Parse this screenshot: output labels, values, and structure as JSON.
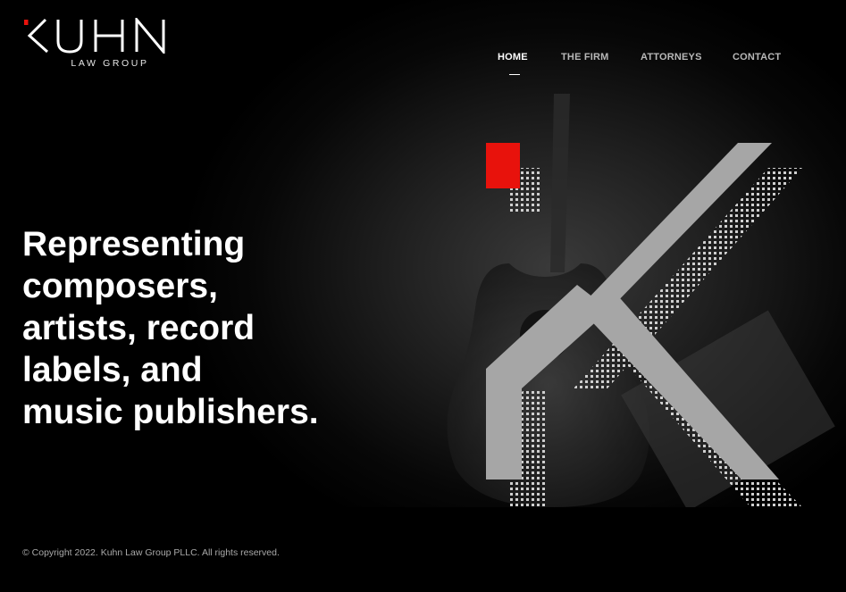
{
  "brand": {
    "logo_main": "KUHN",
    "logo_sub": "LAW GROUP",
    "accent_color": "#e8120c"
  },
  "nav": {
    "items": [
      {
        "label": "HOME",
        "active": true
      },
      {
        "label": "THE FIRM",
        "active": false
      },
      {
        "label": "ATTORNEYS",
        "active": false
      },
      {
        "label": "CONTACT",
        "active": false
      }
    ]
  },
  "hero": {
    "headline_lines": [
      "Representing",
      "composers,",
      "artists, record",
      "labels, and",
      "music publishers."
    ]
  },
  "footer": {
    "copyright": "© Copyright 2022. Kuhn Law Group PLLC. All rights reserved."
  }
}
